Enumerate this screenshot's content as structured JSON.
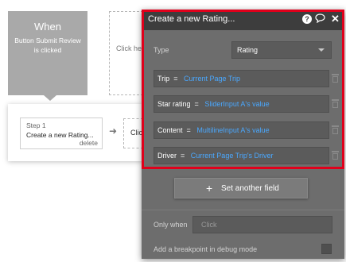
{
  "trigger": {
    "title": "When",
    "description": "Button Submit Review is clicked"
  },
  "placeholder_text": "Click he",
  "step": {
    "number": "Step 1",
    "name": "Create a new Rating...",
    "delete_label": "delete"
  },
  "next_step_text": "Clic",
  "panel": {
    "title": "Create a new Rating...",
    "type_label": "Type",
    "type_value": "Rating",
    "fields": [
      {
        "name": "Trip",
        "eq": "=",
        "value": "Current Page Trip"
      },
      {
        "name": "Star rating",
        "eq": "=",
        "value": "SliderInput A's value"
      },
      {
        "name": "Content",
        "eq": "=",
        "value": "MultilineInput A's value"
      },
      {
        "name": "Driver",
        "eq": "=",
        "value": "Current Page Trip's Driver"
      }
    ],
    "set_another_field": "Set another field",
    "only_when_label": "Only when",
    "only_when_placeholder": "Click",
    "breakpoint_label": "Add a breakpoint in debug mode"
  },
  "colors": {
    "highlight": "#e0001b",
    "dynamic_value": "#4aa8ff",
    "panel_bg": "#6d6d6d",
    "panel_header_bg": "#3d3d3d"
  }
}
